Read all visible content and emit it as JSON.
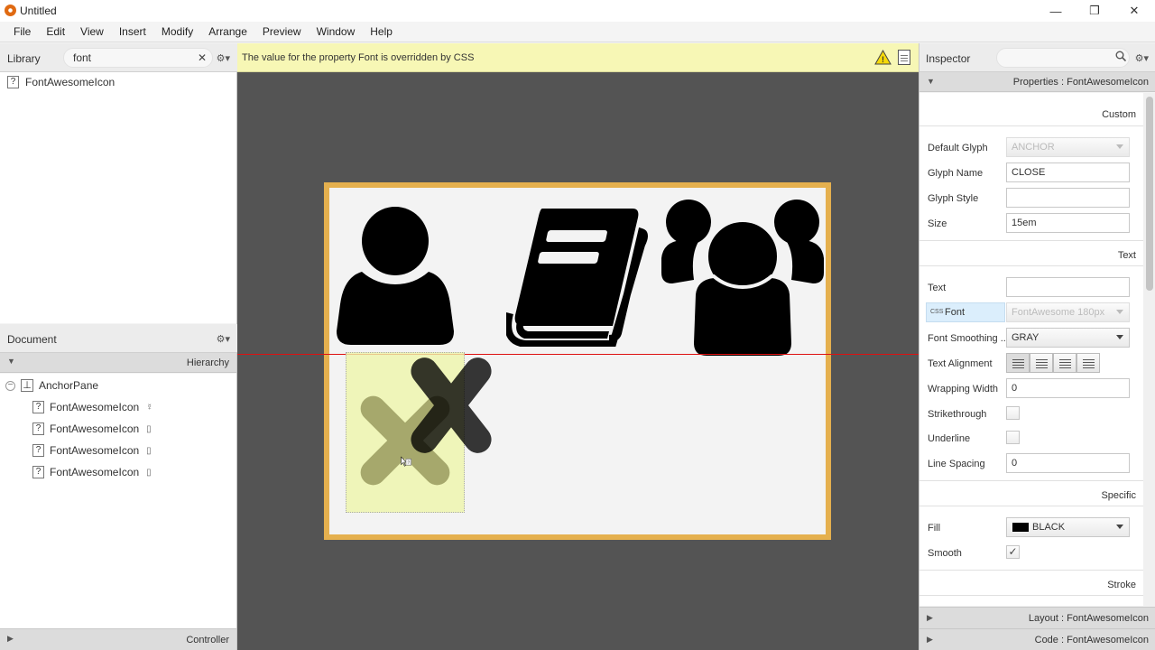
{
  "window": {
    "title": "Untitled",
    "minimize": "—",
    "maximize": "❐",
    "close": "✕"
  },
  "menu": [
    "File",
    "Edit",
    "View",
    "Insert",
    "Modify",
    "Arrange",
    "Preview",
    "Window",
    "Help"
  ],
  "library": {
    "title": "Library",
    "search_value": "font",
    "clear": "✕",
    "settings": "⚙▾",
    "items": [
      {
        "icon": "?",
        "label": "FontAwesomeIcon"
      }
    ]
  },
  "document": {
    "title": "Document",
    "settings": "⚙▾",
    "hierarchy_label": "Hierarchy",
    "root": {
      "label": "AnchorPane",
      "icon": "⊥"
    },
    "children": [
      {
        "label": "FontAwesomeIcon",
        "suffix": "☿"
      },
      {
        "label": "FontAwesomeIcon",
        "suffix": "▯"
      },
      {
        "label": "FontAwesomeIcon",
        "suffix": "▯"
      },
      {
        "label": "FontAwesomeIcon",
        "suffix": "▯"
      }
    ],
    "controller_label": "Controller"
  },
  "canvas": {
    "warning_text": "The value for the property Font is overridden by CSS",
    "warning_glyph": "!",
    "glyphs": [
      "user-icon",
      "book-icon",
      "users-icon",
      "close-icon",
      "close-icon"
    ]
  },
  "inspector": {
    "title": "Inspector",
    "settings": "⚙▾",
    "properties_label": "Properties : FontAwesomeIcon",
    "sections": {
      "custom": "Custom",
      "text": "Text",
      "specific": "Specific",
      "stroke": "Stroke"
    },
    "fields": {
      "default_glyph": {
        "label": "Default Glyph",
        "value": "ANCHOR"
      },
      "glyph_name": {
        "label": "Glyph Name",
        "value": "CLOSE"
      },
      "glyph_style": {
        "label": "Glyph Style",
        "value": ""
      },
      "size": {
        "label": "Size",
        "value": "15em"
      },
      "text": {
        "label": "Text",
        "value": ""
      },
      "font": {
        "label": "Font",
        "tag": "CSS",
        "value": "FontAwesome 180px"
      },
      "font_smoothing": {
        "label": "Font Smoothing ...",
        "value": "GRAY"
      },
      "text_alignment": {
        "label": "Text Alignment"
      },
      "wrapping_width": {
        "label": "Wrapping Width",
        "value": "0"
      },
      "strikethrough": {
        "label": "Strikethrough"
      },
      "underline": {
        "label": "Underline"
      },
      "line_spacing": {
        "label": "Line Spacing",
        "value": "0"
      },
      "fill": {
        "label": "Fill",
        "value": "BLACK"
      },
      "smooth": {
        "label": "Smooth",
        "check": "✓"
      }
    },
    "layout_label": "Layout : FontAwesomeIcon",
    "code_label": "Code : FontAwesomeIcon"
  },
  "colors": {
    "stage_border": "#e5b04e",
    "warning_bg": "#f7f7b5",
    "guide": "#dd1111",
    "canvas_bg": "#545454"
  }
}
